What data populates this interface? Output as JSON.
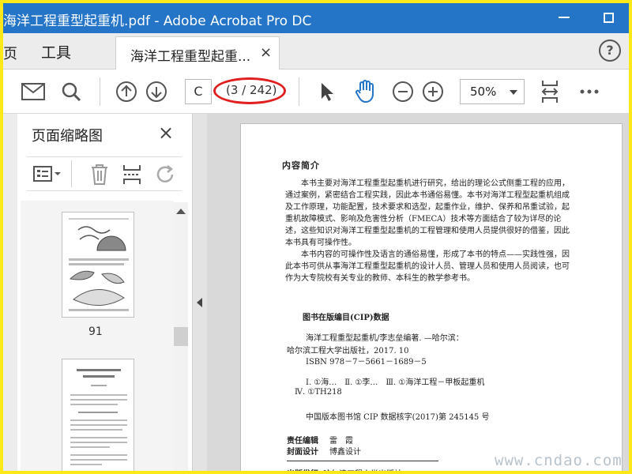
{
  "window": {
    "title": "海洋工程重型起重机.pdf - Adobe Acrobat Pro DC"
  },
  "tabs": {
    "home": "页",
    "tools": "工具",
    "document": "海洋工程重型起重...",
    "close": "×",
    "help": "?"
  },
  "toolbar": {
    "page_input_value": "C",
    "page_count": "(3 / 242)",
    "zoom": "50%",
    "icons": [
      "mail-icon",
      "search-icon",
      "prev-page-icon",
      "next-page-icon",
      "select-cursor-icon",
      "hand-icon",
      "zoom-out-icon",
      "zoom-in-icon",
      "fit-page-icon",
      "more-icon"
    ]
  },
  "sidebar": {
    "title": "页面缩略图",
    "close": "×",
    "thumbnail_label": "91",
    "icons": [
      "options-menu-icon",
      "delete-icon",
      "insert-page-icon",
      "rotate-icon"
    ]
  },
  "page": {
    "heading": "内容简介",
    "para1": "本书主要对海洋工程重型起重机进行研究，给出的理论公式侧重工程的应用，通过案例，紧密结合工程实践，因此本书通俗易懂。本书对海洋工程型起重机组成及工作原理，功能配置，技术要求和选型，起重作业，维护、保养和吊重试验，起重机故障模式、影响及危害性分析（FMECA）技术等方面结合了较为详尽的论述，这些知识对海洋工程重型起重机的工程管理和使用人员提供很好的借鉴，因此本书具有可操作性。",
    "para2": "本书内容的可操作性及语言的通俗易懂，形成了本书的特点——实践性强，因此本书可供从事海洋工程重型起重机的设计人员、管理人员和使用人员阅读，也可作为大专院校有关专业的教师、本科生的教学参考书。",
    "cip_title": "图书在版编目(CIP)数据",
    "cip_line1": "海洋工程重型起重机/李志垒编著. —哈尔滨：",
    "cip_line2": "哈尔滨工程大学出版社，2017. 10",
    "cip_isbn": "ISBN 978－7－5661－1689－5",
    "cip_class1": "Ⅰ. ①海…　Ⅱ. ①李…　Ⅲ. ①海洋工程－甲板起重机",
    "cip_class2": "Ⅳ. ①TH218",
    "cip_record": "中国版本图书馆 CIP 数据核字(2017)第 245145 号",
    "editor_label": "责任编辑",
    "editor_name": "雷　霞",
    "designer_label": "封面设计",
    "designer_name": "博鑫设计",
    "publisher_label": "出版发行",
    "publisher_name": "哈尔滨工程大学出版社"
  },
  "watermark": "www.cndao.com"
}
